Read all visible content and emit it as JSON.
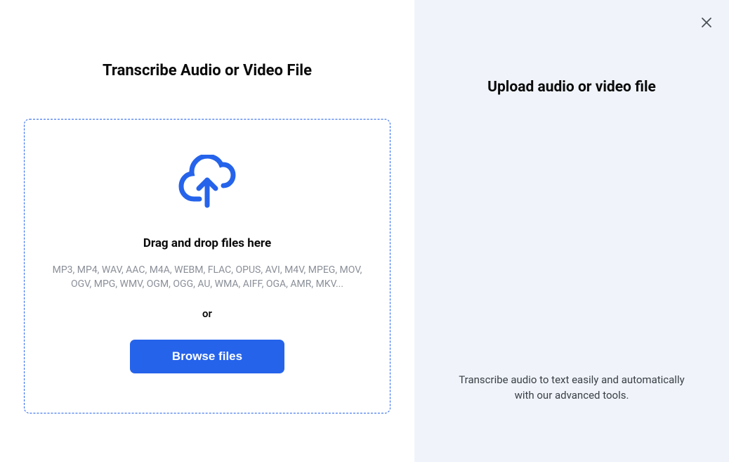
{
  "left": {
    "title": "Transcribe Audio or Video File",
    "dropzone": {
      "instruction": "Drag and drop files here",
      "formats": "MP3, MP4, WAV, AAC, M4A, WEBM, FLAC, OPUS, AVI, M4V, MPEG, MOV, OGV, MPG, WMV, OGM, OGG, AU, WMA, AIFF, OGA, AMR, MKV...",
      "or": "or",
      "browse_label": "Browse files"
    }
  },
  "right": {
    "title": "Upload audio or video file",
    "description": "Transcribe audio to text easily and automatically with our advanced tools."
  },
  "colors": {
    "accent": "#2563eb",
    "panel_bg": "#f0f4fa",
    "muted_text": "#8a8f98"
  }
}
